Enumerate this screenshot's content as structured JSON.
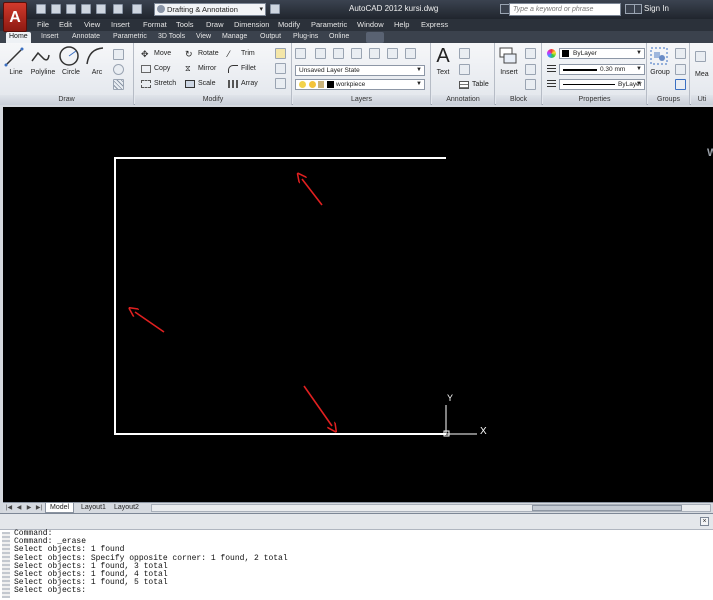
{
  "titlebar": {
    "app_icon_letter": "A",
    "workspace": "Drafting & Annotation",
    "title": "AutoCAD 2012   kursi.dwg",
    "search_placeholder": "Type a keyword or phrase",
    "signin": "Sign In"
  },
  "menu": [
    "File",
    "Edit",
    "View",
    "Insert",
    "Format",
    "Tools",
    "Draw",
    "Dimension",
    "Modify",
    "Parametric",
    "Window",
    "Help",
    "Express"
  ],
  "ribbon_tabs": [
    "Home",
    "Insert",
    "Annotate",
    "Parametric",
    "3D Tools",
    "View",
    "Manage",
    "Output",
    "Plug-ins",
    "Online"
  ],
  "active_tab": "Home",
  "ribbon": {
    "draw": {
      "title": "Draw",
      "tools": [
        "Line",
        "Polyline",
        "Circle",
        "Arc"
      ]
    },
    "modify": {
      "title": "Modify",
      "tools": [
        "Move",
        "Rotate",
        "Trim",
        "Copy",
        "Mirror",
        "Fillet",
        "Stretch",
        "Scale",
        "Array"
      ]
    },
    "layers": {
      "title": "Layers",
      "layer_state": "Unsaved Layer State",
      "current_layer": "workpiece"
    },
    "annotation": {
      "title": "Annotation",
      "text_label": "Text",
      "table_label": "Table"
    },
    "block": {
      "title": "Block",
      "insert_label": "Insert"
    },
    "properties": {
      "title": "Properties",
      "color": "ByLayer",
      "lineweight": "0.30 mm",
      "linetype": "ByLayer"
    },
    "groups": {
      "title": "Groups",
      "group_label": "Group"
    },
    "utilities": {
      "title": "Uti",
      "measure_label": "Mea"
    }
  },
  "drawing": {
    "background": "#000000",
    "line_color": "#ffffff",
    "arrow_color": "#e02020",
    "ucs_x_label": "X",
    "ucs_y_label": "Y",
    "right_edge_letter": "W"
  },
  "layout_tabs": [
    "Model",
    "Layout1",
    "Layout2"
  ],
  "active_layout": "Model",
  "command_history": [
    "Command:",
    "Command: _erase",
    "Select objects: 1 found",
    "Select objects: Specify opposite corner: 1 found, 2 total",
    "Select objects: 1 found, 3 total",
    "Select objects: 1 found, 4 total",
    "Select objects: 1 found, 5 total",
    "Select objects:"
  ],
  "colors": {
    "app_red": "#c62a1e",
    "title_dark": "#2b313a"
  }
}
